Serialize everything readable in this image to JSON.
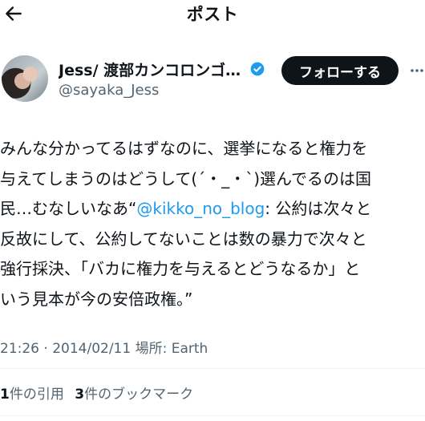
{
  "header": {
    "title": "ポスト",
    "back_icon": "arrow-left-icon"
  },
  "author": {
    "display_name": "Jess/ 渡部カンコロンゴ…",
    "handle": "@sayaka_Jess",
    "verified_icon": "verified-badge-icon",
    "verified_color": "#1d9bf0"
  },
  "follow_button": {
    "label": "フォローする"
  },
  "more_icon": "more-options-icon",
  "tweet": {
    "line1": "みんな分かってるはずなのに、選挙になると権力を",
    "line2": "与えてしまうのはどうして(´・_・`)選んでるのは国",
    "line3_before": "民…むなしいなあ“",
    "mention": "@kikko_no_blog",
    "line3_after": ": 公約は次々と",
    "line4": "反故にして、公約してないことは数の暴力で次々と",
    "line5": "強行採決、「バカに権力を与えるとどうなるか」と",
    "line6": "いう見本が今の安倍政権。”"
  },
  "meta": {
    "text": "21:26 · 2014/02/11 場所: Earth"
  },
  "stats": {
    "quotes_count": "1",
    "quotes_label": "件の引用",
    "bookmarks_count": "3",
    "bookmarks_label": "件のブックマーク"
  },
  "colors": {
    "text": "#0f1419",
    "secondary": "#536471",
    "link": "#1d9bf0",
    "button_bg": "#0f1419"
  }
}
